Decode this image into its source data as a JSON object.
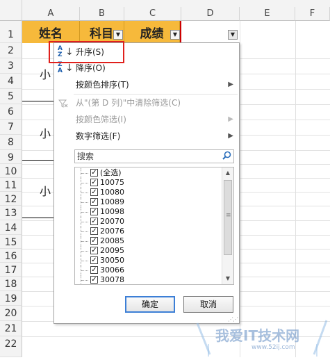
{
  "columns": [
    "A",
    "B",
    "C",
    "D",
    "E",
    "F"
  ],
  "rows": [
    "1",
    "2",
    "3",
    "4",
    "5",
    "6",
    "7",
    "8",
    "9",
    "10",
    "11",
    "12",
    "13",
    "14",
    "15",
    "16",
    "17",
    "18",
    "19",
    "20",
    "21",
    "22"
  ],
  "table_headers": [
    {
      "label": "姓名"
    },
    {
      "label": "科目"
    },
    {
      "label": "成绩"
    }
  ],
  "names_visible": [
    "小明",
    "小红",
    "小刚"
  ],
  "names_partial": [
    "小",
    "小",
    "小"
  ],
  "menu": {
    "sort_asc": "升序(S)",
    "sort_desc": "降序(O)",
    "sort_by_color": "按颜色排序(T)",
    "clear_filter": "从\"(第 D 列)\"中清除筛选(C)",
    "filter_by_color": "按颜色筛选(I)",
    "number_filter": "数字筛选(F)"
  },
  "search": {
    "placeholder": "搜索"
  },
  "filter_list": [
    "(全选)",
    "10075",
    "10080",
    "10089",
    "10098",
    "20070",
    "20076",
    "20085",
    "20095",
    "30050",
    "30066",
    "30078"
  ],
  "buttons": {
    "ok": "确定",
    "cancel": "取消"
  },
  "watermark": {
    "text": "我爱IT技术网",
    "url": "www.52ij.com"
  }
}
